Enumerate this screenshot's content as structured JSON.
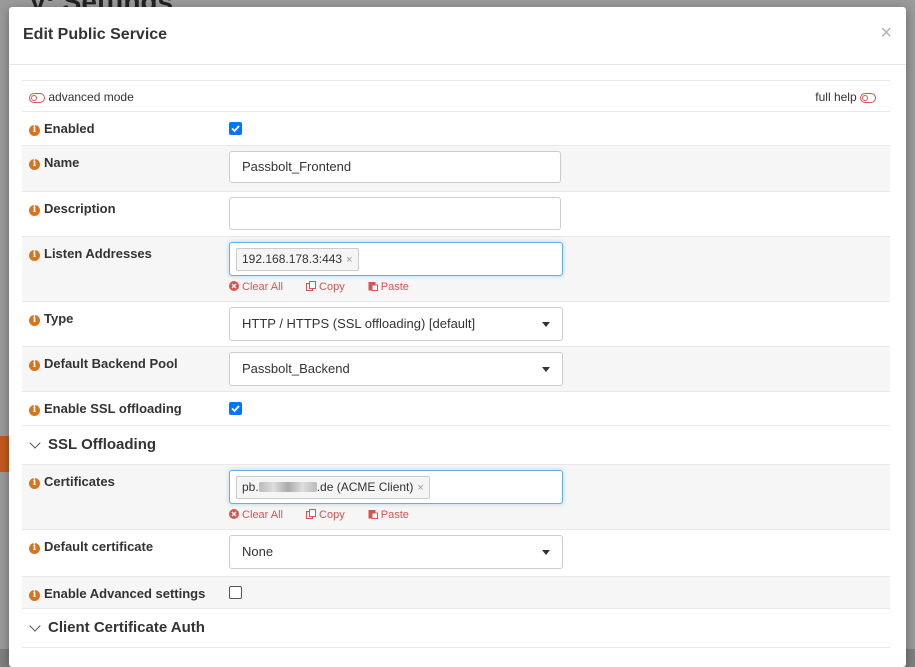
{
  "background": {
    "title": "y: Settings"
  },
  "modal": {
    "title": "Edit Public Service",
    "close_glyph": "×",
    "advanced_mode": "advanced mode",
    "full_help": "full help"
  },
  "fields": {
    "enabled": {
      "label": "Enabled",
      "checked": true
    },
    "name": {
      "label": "Name",
      "value": "Passbolt_Frontend"
    },
    "description": {
      "label": "Description",
      "value": ""
    },
    "listen_addresses": {
      "label": "Listen Addresses",
      "tags": [
        "192.168.178.3:443"
      ]
    },
    "type": {
      "label": "Type",
      "value": "HTTP / HTTPS (SSL offloading) [default]"
    },
    "default_backend_pool": {
      "label": "Default Backend Pool",
      "value": "Passbolt_Backend"
    },
    "enable_ssl_offloading": {
      "label": "Enable SSL offloading",
      "checked": true
    },
    "certificates": {
      "label": "Certificates",
      "tag_prefix": "pb.",
      "tag_suffix": ".de (ACME Client)"
    },
    "default_certificate": {
      "label": "Default certificate",
      "value": "None"
    },
    "enable_advanced_settings": {
      "label": "Enable Advanced settings",
      "checked": false
    }
  },
  "tag_actions": {
    "clear_all": "Clear All",
    "copy": "Copy",
    "paste": "Paste"
  },
  "sections": {
    "ssl_offloading": "SSL Offloading",
    "client_cert_auth": "Client Certificate Auth"
  },
  "colors": {
    "accent_red": "#d9534f",
    "info_orange": "#d9731c",
    "checkbox_blue": "#0075ff",
    "focus_blue": "#66afe9"
  }
}
